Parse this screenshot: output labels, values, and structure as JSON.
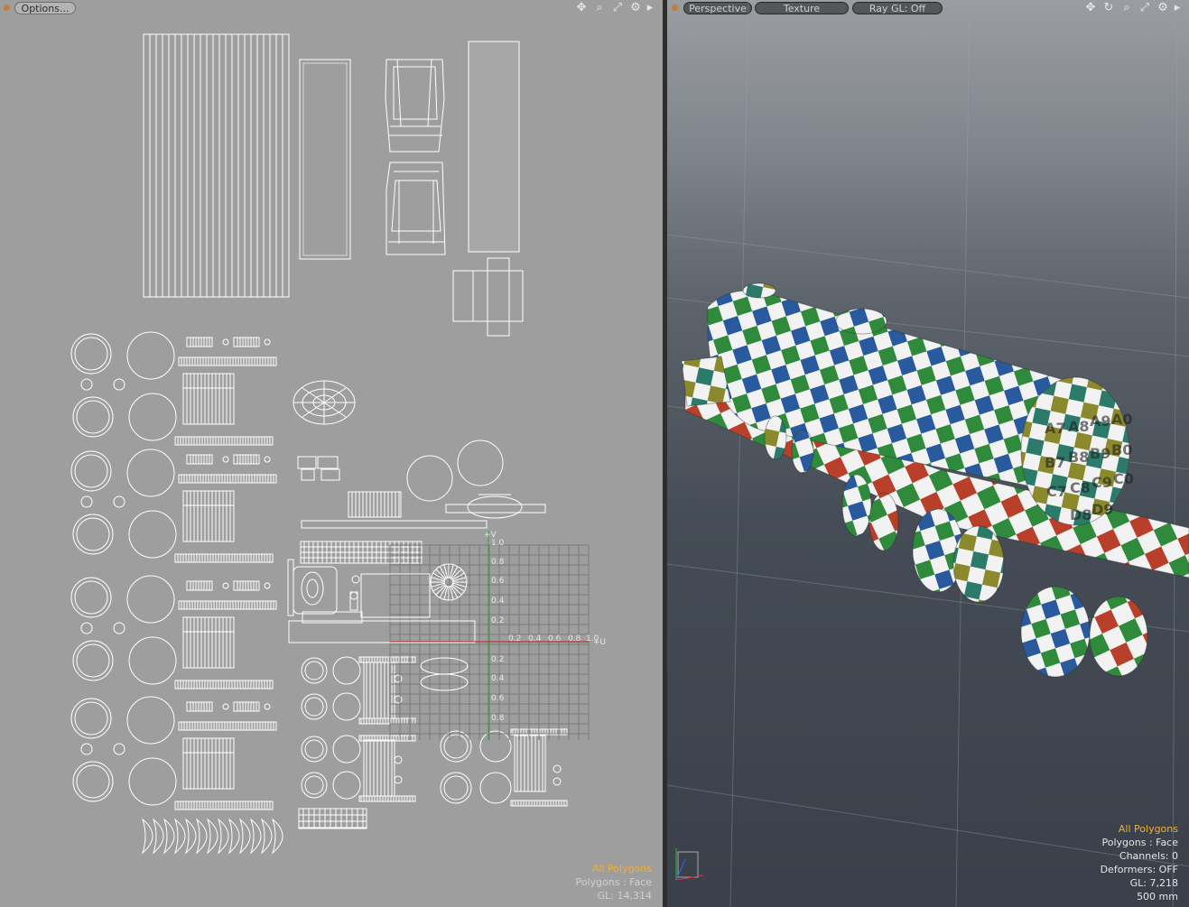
{
  "uv_viewport": {
    "options_label": "Options...",
    "icons": [
      "move-icon",
      "zoom-icon",
      "fit-icon",
      "gear-icon",
      "expand-arrow-icon"
    ],
    "axis_v_label": "+V",
    "axis_u_label": "+U",
    "v_ticks": [
      "1.0",
      "0.8",
      "0.6",
      "0.4",
      "0.2",
      "0.2",
      "0.4",
      "0.6",
      "0.8"
    ],
    "u_ticks": [
      "0.2",
      "0.4",
      "0.6",
      "0.8",
      "1.0"
    ],
    "info": {
      "selection": "All Polygons",
      "mode": "Polygons : Face",
      "gl": "GL: 14,314"
    }
  },
  "persp_viewport": {
    "view_label": "Perspective",
    "shading_label": "Texture",
    "raygl_label": "Ray GL: Off",
    "icons": [
      "move-icon",
      "rotate-icon",
      "zoom-icon",
      "fit-icon",
      "gear-icon",
      "expand-arrow-icon"
    ],
    "info": {
      "selection": "All Polygons",
      "mode": "Polygons : Face",
      "channels": "Channels: 0",
      "deformers": "Deformers: OFF",
      "gl": "GL: 7,218",
      "scale": "500 mm"
    },
    "checker_labels": [
      "A7",
      "A8",
      "A9",
      "A0",
      "B7",
      "B8",
      "B9",
      "B0",
      "C7",
      "C8",
      "C9",
      "C0",
      "D8",
      "D9"
    ],
    "colors": {
      "checker_white": "#f2f2f2",
      "green": "#2f8a3c",
      "blue": "#2a5a9e",
      "olive": "#8a8a2c",
      "red": "#b8402a",
      "teal": "#2b7a6a"
    }
  }
}
